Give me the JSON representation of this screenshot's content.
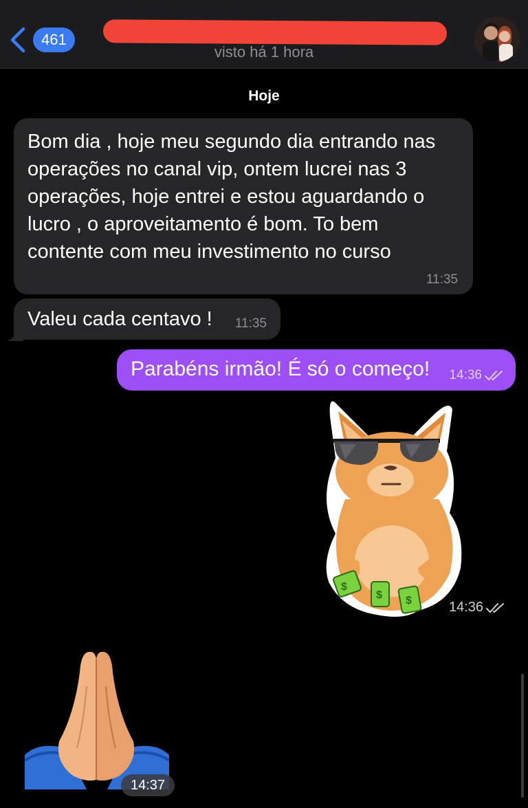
{
  "header": {
    "back_count": "461",
    "status": "visto há 1 hora"
  },
  "day_label": "Hoje",
  "messages": [
    {
      "direction": "in",
      "text": "Bom dia , hoje meu segundo dia entrando nas operações no canal vip, ontem lucrei nas 3 operações, hoje entrei e estou aguardando o lucro , o aproveitamento é bom. To bem contente com meu investimento no curso",
      "time": "11:35"
    },
    {
      "direction": "in",
      "text": "Valeu cada centavo !",
      "time": "11:35"
    },
    {
      "direction": "out",
      "text": "Parabéns irmão! É só o começo!",
      "time": "14:36",
      "read": true
    },
    {
      "direction": "out",
      "type": "sticker",
      "sticker": "cool-cat-with-money",
      "time": "14:36",
      "read": true
    },
    {
      "direction": "in",
      "type": "emoji",
      "emoji": "folded-hands",
      "time": "14:37"
    }
  ],
  "colors": {
    "background": "#000000",
    "header": "#1c1c1e",
    "incoming_bubble": "#262628",
    "outgoing_bubble": "#9b4ff5",
    "badge": "#3a7bf2",
    "redaction": "#f2453a"
  }
}
